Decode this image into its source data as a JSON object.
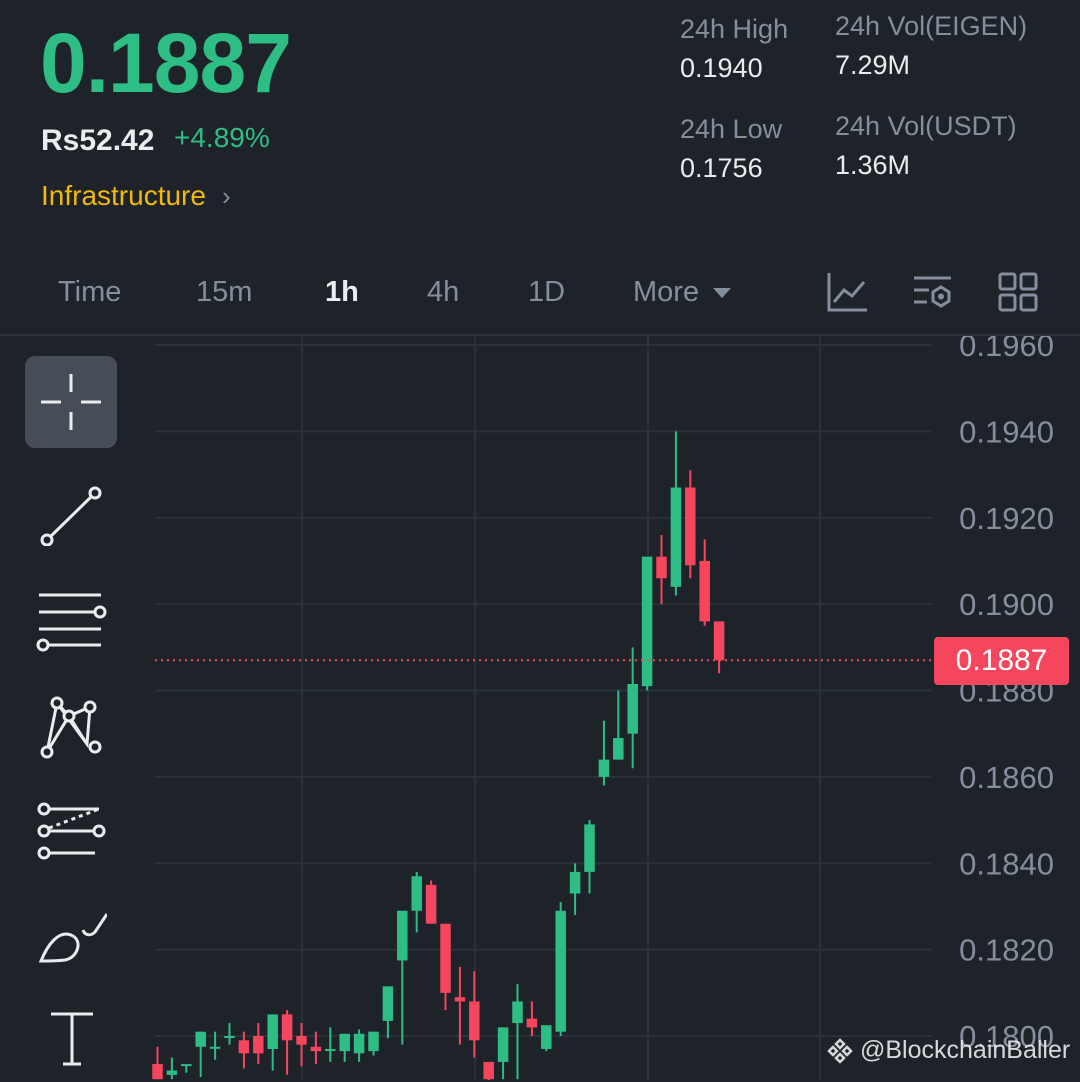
{
  "header": {
    "last_price": "0.1887",
    "fiat_price": "Rs52.42",
    "change_pct": "+4.89%",
    "category": "Infrastructure",
    "stats": {
      "high_label": "24h High",
      "high_value": "0.1940",
      "low_label": "24h Low",
      "low_value": "0.1756",
      "vol_base_label": "24h Vol(EIGEN)",
      "vol_base_value": "7.29M",
      "vol_quote_label": "24h Vol(USDT)",
      "vol_quote_value": "1.36M"
    }
  },
  "toolbar": {
    "tabs": [
      {
        "label": "Time",
        "active": false
      },
      {
        "label": "15m",
        "active": false
      },
      {
        "label": "1h",
        "active": true
      },
      {
        "label": "4h",
        "active": false
      },
      {
        "label": "1D",
        "active": false
      },
      {
        "label": "More",
        "active": false
      }
    ],
    "icons": [
      "indicator-icon",
      "settings-icon",
      "layout-grid-icon"
    ]
  },
  "drawing_tools": [
    "crosshair-icon",
    "trend-line-icon",
    "horizontal-lines-icon",
    "pattern-icon",
    "fib-channel-icon",
    "brush-icon",
    "text-icon"
  ],
  "colors": {
    "up": "#2ebd85",
    "down": "#f6465d",
    "accent": "#f0b90b",
    "background": "#1e2329"
  },
  "watermark": "@BlockchainBaller",
  "chart_data": {
    "type": "candlestick",
    "y_ticks": [
      "0.1960",
      "0.1940",
      "0.1920",
      "0.1900",
      "0.1880",
      "0.1860",
      "0.1840",
      "0.1820",
      "0.1800"
    ],
    "ylim": [
      0.17905,
      0.19635
    ],
    "current_price": "0.1887",
    "grid": true,
    "candles": [
      {
        "o": 0.17935,
        "h": 0.17975,
        "l": 0.179,
        "c": 0.179
      },
      {
        "o": 0.1791,
        "h": 0.1795,
        "l": 0.179,
        "c": 0.1792
      },
      {
        "o": 0.17935,
        "h": 0.17935,
        "l": 0.17915,
        "c": 0.17935
      },
      {
        "o": 0.17975,
        "h": 0.1801,
        "l": 0.17905,
        "c": 0.1801
      },
      {
        "o": 0.17975,
        "h": 0.1801,
        "l": 0.17945,
        "c": 0.17975
      },
      {
        "o": 0.18,
        "h": 0.1803,
        "l": 0.1798,
        "c": 0.18
      },
      {
        "o": 0.1799,
        "h": 0.1801,
        "l": 0.17925,
        "c": 0.1796
      },
      {
        "o": 0.18,
        "h": 0.1803,
        "l": 0.17935,
        "c": 0.1796
      },
      {
        "o": 0.1797,
        "h": 0.1805,
        "l": 0.1792,
        "c": 0.1805
      },
      {
        "o": 0.1805,
        "h": 0.1806,
        "l": 0.1791,
        "c": 0.1799
      },
      {
        "o": 0.18,
        "h": 0.1803,
        "l": 0.1793,
        "c": 0.1798
      },
      {
        "o": 0.17975,
        "h": 0.1801,
        "l": 0.17935,
        "c": 0.17965
      },
      {
        "o": 0.1797,
        "h": 0.1802,
        "l": 0.1794,
        "c": 0.1797
      },
      {
        "o": 0.17965,
        "h": 0.1799,
        "l": 0.1794,
        "c": 0.18005
      },
      {
        "o": 0.1796,
        "h": 0.18015,
        "l": 0.1794,
        "c": 0.18005
      },
      {
        "o": 0.17965,
        "h": 0.1801,
        "l": 0.17955,
        "c": 0.1801
      },
      {
        "o": 0.18035,
        "h": 0.1809,
        "l": 0.17995,
        "c": 0.18115
      },
      {
        "o": 0.18175,
        "h": 0.1825,
        "l": 0.1798,
        "c": 0.1829
      },
      {
        "o": 0.1829,
        "h": 0.1838,
        "l": 0.1824,
        "c": 0.1837
      },
      {
        "o": 0.1835,
        "h": 0.1836,
        "l": 0.1826,
        "c": 0.1826
      },
      {
        "o": 0.1826,
        "h": 0.1826,
        "l": 0.1806,
        "c": 0.181
      },
      {
        "o": 0.1809,
        "h": 0.1816,
        "l": 0.1798,
        "c": 0.1808
      },
      {
        "o": 0.1808,
        "h": 0.1815,
        "l": 0.1795,
        "c": 0.1799
      },
      {
        "o": 0.1794,
        "h": 0.1794,
        "l": 0.1788,
        "c": 0.179
      },
      {
        "o": 0.1794,
        "h": 0.1802,
        "l": 0.179,
        "c": 0.1802
      },
      {
        "o": 0.1803,
        "h": 0.1812,
        "l": 0.179,
        "c": 0.1808
      },
      {
        "o": 0.1804,
        "h": 0.1808,
        "l": 0.18,
        "c": 0.1802
      },
      {
        "o": 0.1797,
        "h": 0.1802,
        "l": 0.17965,
        "c": 0.18025
      },
      {
        "o": 0.1801,
        "h": 0.1831,
        "l": 0.18,
        "c": 0.1829
      },
      {
        "o": 0.1833,
        "h": 0.184,
        "l": 0.1828,
        "c": 0.1838
      },
      {
        "o": 0.1838,
        "h": 0.185,
        "l": 0.1833,
        "c": 0.1849
      },
      {
        "o": 0.186,
        "h": 0.1873,
        "l": 0.1858,
        "c": 0.1864
      },
      {
        "o": 0.1864,
        "h": 0.188,
        "l": 0.1864,
        "c": 0.1869
      },
      {
        "o": 0.187,
        "h": 0.189,
        "l": 0.1862,
        "c": 0.18815
      },
      {
        "o": 0.1881,
        "h": 0.191,
        "l": 0.188,
        "c": 0.1911
      },
      {
        "o": 0.1911,
        "h": 0.1916,
        "l": 0.19,
        "c": 0.1906
      },
      {
        "o": 0.1904,
        "h": 0.194,
        "l": 0.1902,
        "c": 0.1927
      },
      {
        "o": 0.1927,
        "h": 0.1931,
        "l": 0.1906,
        "c": 0.1909
      },
      {
        "o": 0.191,
        "h": 0.1915,
        "l": 0.1895,
        "c": 0.1896
      },
      {
        "o": 0.1896,
        "h": 0.1896,
        "l": 0.1884,
        "c": 0.1887
      }
    ]
  }
}
